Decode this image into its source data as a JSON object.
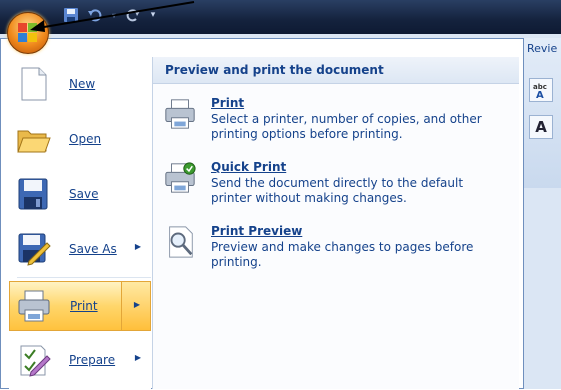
{
  "ribbon": {
    "visible_tab": "Revie",
    "buttons": [
      "A",
      "A"
    ]
  },
  "quick_access": {
    "items": [
      "save-icon",
      "undo-icon",
      "dropdown-arrow",
      "redo-icon",
      "customize-icon"
    ]
  },
  "office_menu": {
    "items": [
      {
        "label": "New",
        "icon": "new-document-icon",
        "has_submenu": false
      },
      {
        "label": "Open",
        "icon": "open-folder-icon",
        "has_submenu": false
      },
      {
        "label": "Save",
        "icon": "save-floppy-icon",
        "has_submenu": false
      },
      {
        "label": "Save As",
        "icon": "save-as-icon",
        "has_submenu": true
      },
      {
        "label": "Print",
        "icon": "printer-icon",
        "has_submenu": true,
        "active": true
      },
      {
        "label": "Prepare",
        "icon": "prepare-icon",
        "has_submenu": true
      }
    ],
    "submenu_arrow": "▶"
  },
  "print_panel": {
    "heading": "Preview and print the document",
    "options": [
      {
        "title": "Print",
        "description": "Select a printer, number of copies, and other printing options before printing.",
        "icon": "printer-icon"
      },
      {
        "title": "Quick Print",
        "description": "Send the document directly to the default printer without making changes.",
        "icon": "quick-print-icon"
      },
      {
        "title": "Print Preview",
        "description": "Preview and make changes to pages before printing.",
        "icon": "print-preview-icon"
      }
    ]
  },
  "colors": {
    "menu_text": "#15428b",
    "active_highlight": "#ffd66b",
    "title_bar": "#14223d"
  }
}
